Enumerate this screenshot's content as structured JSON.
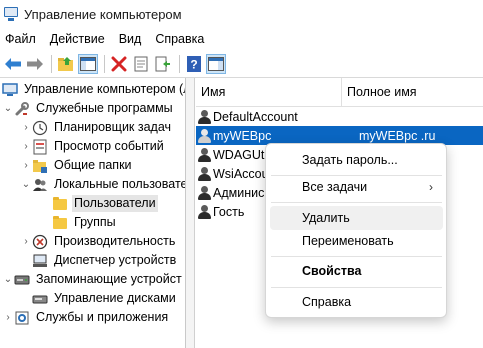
{
  "window": {
    "title": "Управление компьютером"
  },
  "menu": {
    "items": [
      "Файл",
      "Действие",
      "Вид",
      "Справка"
    ]
  },
  "toolbar": {
    "buttons": [
      "back-icon",
      "forward-icon",
      "up-folder-icon",
      "show-hide-tree-icon",
      "delete-icon",
      "properties-icon",
      "export-list-icon",
      "help-icon",
      "action-pane-icon"
    ]
  },
  "tree": {
    "items": [
      {
        "label": "Управление компьютером (л",
        "level": 0
      },
      {
        "label": "Служебные программы",
        "level": 1
      },
      {
        "label": "Планировщик задач",
        "level": 2
      },
      {
        "label": "Просмотр событий",
        "level": 2
      },
      {
        "label": "Общие папки",
        "level": 2
      },
      {
        "label": "Локальные пользовате",
        "level": 2
      },
      {
        "label": "Пользователи",
        "level": 3,
        "selected": true
      },
      {
        "label": "Группы",
        "level": 3
      },
      {
        "label": "Производительность",
        "level": 2
      },
      {
        "label": "Диспетчер устройств",
        "level": 2
      },
      {
        "label": "Запоминающие устройст",
        "level": 1
      },
      {
        "label": "Управление дисками",
        "level": 2
      },
      {
        "label": "Службы и приложения",
        "level": 1
      }
    ]
  },
  "list": {
    "columns": {
      "name": "Имя",
      "full_name": "Полное имя"
    },
    "rows": [
      {
        "name": "DefaultAccount",
        "full_name": ""
      },
      {
        "name": "myWEBpc",
        "full_name": "myWEBpc .ru",
        "selected": true
      },
      {
        "name": "WDAGUti",
        "full_name": ""
      },
      {
        "name": "WsiAccou",
        "full_name": ""
      },
      {
        "name": "Админис",
        "full_name": ""
      },
      {
        "name": "Гость",
        "full_name": ""
      }
    ]
  },
  "context_menu": {
    "set_password": "Задать пароль...",
    "all_tasks": "Все задачи",
    "all_tasks_arrow": "›",
    "delete": "Удалить",
    "rename": "Переименовать",
    "properties": "Свойства",
    "help": "Справка"
  },
  "colors": {
    "selection": "#0a66c2",
    "accent": "#2c6fb6"
  }
}
